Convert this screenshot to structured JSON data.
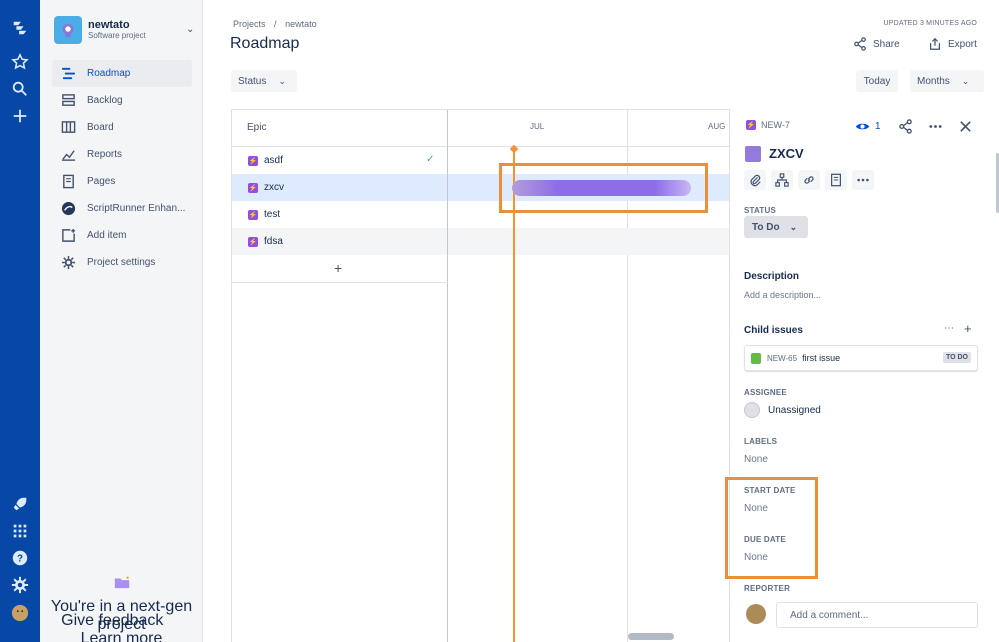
{
  "sidebar": {
    "project_name": "newtato",
    "project_type": "Software project",
    "items": [
      {
        "label": "Roadmap"
      },
      {
        "label": "Backlog"
      },
      {
        "label": "Board"
      },
      {
        "label": "Reports"
      },
      {
        "label": "Pages"
      },
      {
        "label": "ScriptRunner Enhan..."
      },
      {
        "label": "Add item"
      },
      {
        "label": "Project settings"
      }
    ],
    "footer_text": "You're in a next-gen project",
    "feedback_link": "Give feedback",
    "learn_link": "Learn more"
  },
  "header": {
    "breadcrumb_projects": "Projects",
    "breadcrumb_sep": "/",
    "breadcrumb_project": "newtato",
    "title": "Roadmap",
    "updated": "UPDATED 3 MINUTES AGO",
    "share": "Share",
    "export": "Export"
  },
  "toolbar": {
    "status_filter": "Status",
    "today": "Today",
    "months": "Months"
  },
  "roadmap": {
    "epic_header": "Epic",
    "months": [
      "JUL",
      "AUG"
    ],
    "epics": [
      {
        "name": "asdf",
        "done": true
      },
      {
        "name": "zxcv",
        "done": false
      },
      {
        "name": "test",
        "done": false
      },
      {
        "name": "fdsa",
        "done": false
      }
    ],
    "add_symbol": "+"
  },
  "detail": {
    "issue_key": "NEW-7",
    "watchers": "1",
    "title": "ZXCV",
    "status_label": "STATUS",
    "status_value": "To Do",
    "description_label": "Description",
    "description_placeholder": "Add a description...",
    "child_issues_label": "Child issues",
    "child": {
      "key": "NEW-65",
      "summary": "first issue",
      "status": "TO DO"
    },
    "assignee_label": "ASSIGNEE",
    "assignee_value": "Unassigned",
    "labels_label": "LABELS",
    "labels_value": "None",
    "start_date_label": "START DATE",
    "start_date_value": "None",
    "due_date_label": "DUE DATE",
    "due_date_value": "None",
    "reporter_label": "REPORTER",
    "comment_placeholder": "Add a comment..."
  },
  "colors": {
    "global_nav": "#0747a6",
    "epic_purple": "#904ee2",
    "highlight": "#e8913a",
    "today_line": "#f79233"
  }
}
